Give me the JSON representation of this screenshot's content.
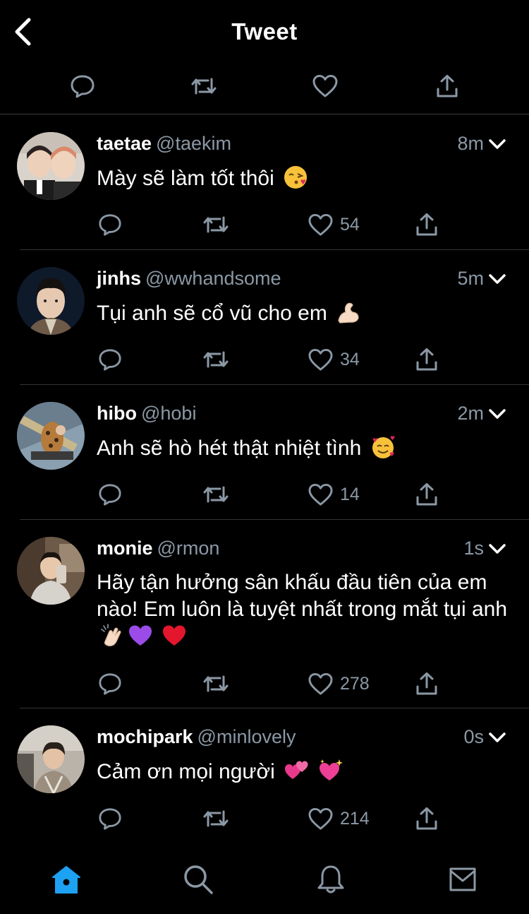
{
  "header": {
    "title": "Tweet"
  },
  "icons": {
    "back": "chevron-left-icon",
    "reply": "reply-icon",
    "retweet": "retweet-icon",
    "like": "heart-icon",
    "share": "share-icon",
    "more": "chevron-down-icon"
  },
  "colors": {
    "accent": "#1da1f2",
    "muted": "#8b98a5",
    "background": "#000000",
    "divider": "#333333"
  },
  "tweets": [
    {
      "name": "taetae",
      "handle": "@taekim",
      "time": "8m",
      "text": "Mày sẽ làm tốt thôi",
      "emojis": [
        "kissing-face-emoji"
      ],
      "likes": "54"
    },
    {
      "name": "jinhs",
      "handle": "@wwhandsome",
      "time": "5m",
      "text": "Tụi anh sẽ cổ vũ cho em",
      "emojis": [
        "flexed-biceps-emoji"
      ],
      "likes": "34"
    },
    {
      "name": "hibo",
      "handle": "@hobi",
      "time": "2m",
      "text": "Anh sẽ hò hét thật nhiệt tình",
      "emojis": [
        "smiling-face-with-hearts-emoji"
      ],
      "likes": "14"
    },
    {
      "name": "monie",
      "handle": "@rmon",
      "time": "1s",
      "text": "Hãy tận hưởng sân khấu đầu tiên của em nào! Em luôn là tuyệt nhất trong mắt tụi anh",
      "emojis": [
        "clapping-hands-emoji",
        "purple-heart-emoji",
        "red-heart-emoji"
      ],
      "likes": "278"
    },
    {
      "name": "mochipark",
      "handle": "@minlovely",
      "time": "0s",
      "text": "Cảm ơn mọi người",
      "emojis": [
        "two-hearts-emoji",
        "sparkling-heart-emoji"
      ],
      "likes": "214"
    }
  ],
  "tabbar": {
    "active": "home",
    "tabs": [
      "home-icon",
      "search-icon",
      "bell-icon",
      "mail-icon"
    ]
  }
}
